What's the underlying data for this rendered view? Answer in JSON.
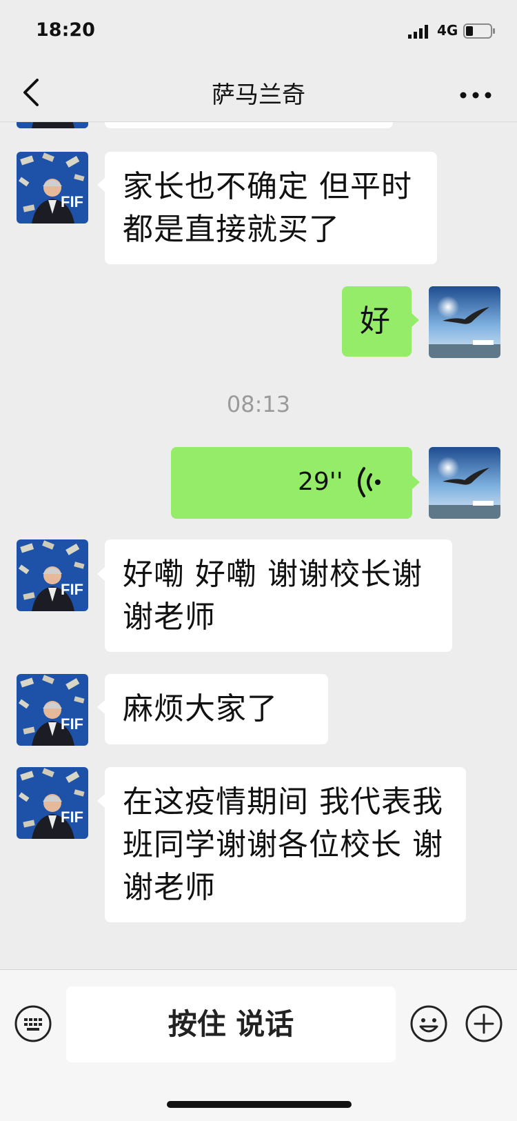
{
  "status_bar": {
    "time": "18:20",
    "network": "4G"
  },
  "header": {
    "title": "萨马兰奇"
  },
  "messages": [
    {
      "text": "家长也不确定 但平时都是直接就买了"
    },
    {
      "text": "好"
    },
    {
      "timestamp": "08:13"
    },
    {
      "voice_duration": "29''"
    },
    {
      "text": "好嘞 好嘞 谢谢校长谢谢老师"
    },
    {
      "text": "麻烦大家了"
    },
    {
      "text": "在这疫情期间 我代表我班同学谢谢各位校长 谢谢老师"
    }
  ],
  "input_bar": {
    "hold_to_talk_label": "按住 说话"
  },
  "colors": {
    "outgoing_bubble": "#95ec69",
    "incoming_bubble": "#ffffff",
    "chat_background": "#ededed"
  }
}
